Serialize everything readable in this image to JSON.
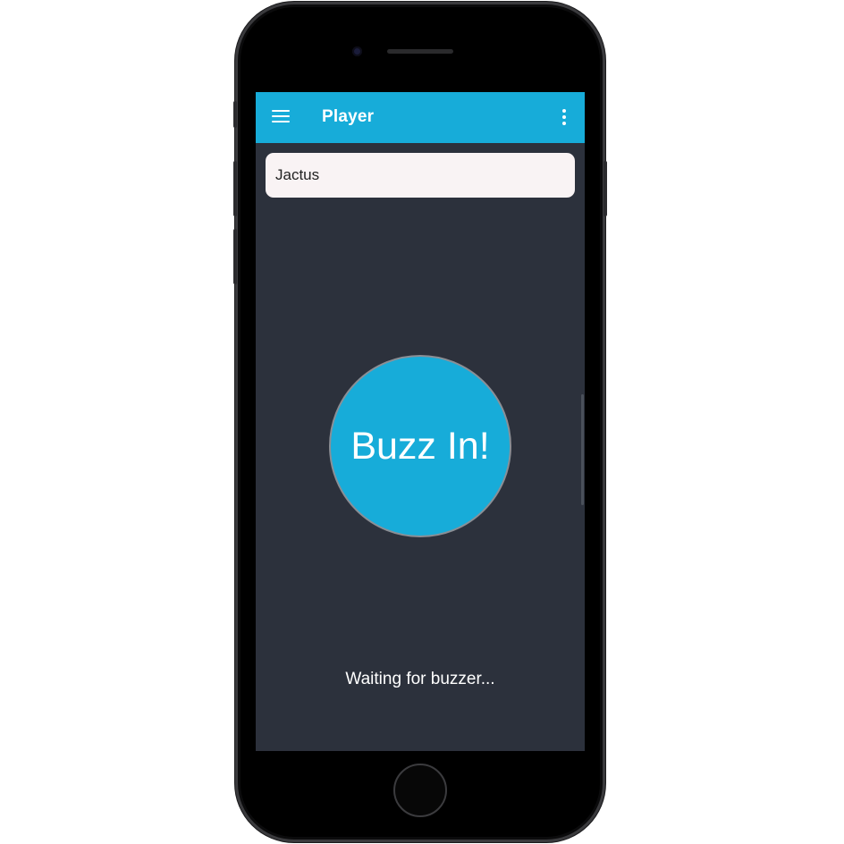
{
  "app_bar": {
    "title": "Player",
    "menu_icon": "hamburger-menu-icon",
    "overflow_icon": "more-vert-icon"
  },
  "name_field": {
    "value": "Jactus"
  },
  "buzz_button": {
    "label": "Buzz In!"
  },
  "status": {
    "text": "Waiting for buzzer..."
  },
  "colors": {
    "accent": "#17acd9",
    "background": "#2c313c",
    "field_background": "#f9f3f4"
  }
}
